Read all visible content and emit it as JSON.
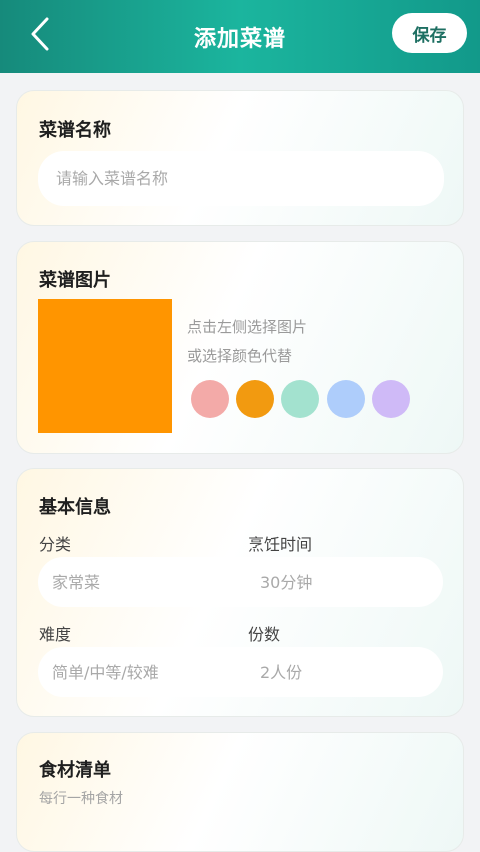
{
  "header": {
    "title": "添加菜谱",
    "save_label": "保存"
  },
  "name_section": {
    "title": "菜谱名称",
    "placeholder": "请输入菜谱名称",
    "value": ""
  },
  "image_section": {
    "title": "菜谱图片",
    "hint_line1": "点击左侧选择图片",
    "hint_line2": "或选择颜色代替",
    "selected_color": "#ff9500",
    "swatches": [
      "#f3aaa8",
      "#f29a10",
      "#a3e2cf",
      "#aecdfb",
      "#cfbaf7"
    ]
  },
  "basic_section": {
    "title": "基本信息",
    "category": {
      "label": "分类",
      "placeholder": "家常菜"
    },
    "cook_time": {
      "label": "烹饪时间",
      "placeholder": "30分钟"
    },
    "difficulty": {
      "label": "难度",
      "placeholder": "简单/中等/较难"
    },
    "servings": {
      "label": "份数",
      "placeholder": "2人份"
    }
  },
  "ingredients_section": {
    "title": "食材清单",
    "hint": "每行一种食材"
  }
}
